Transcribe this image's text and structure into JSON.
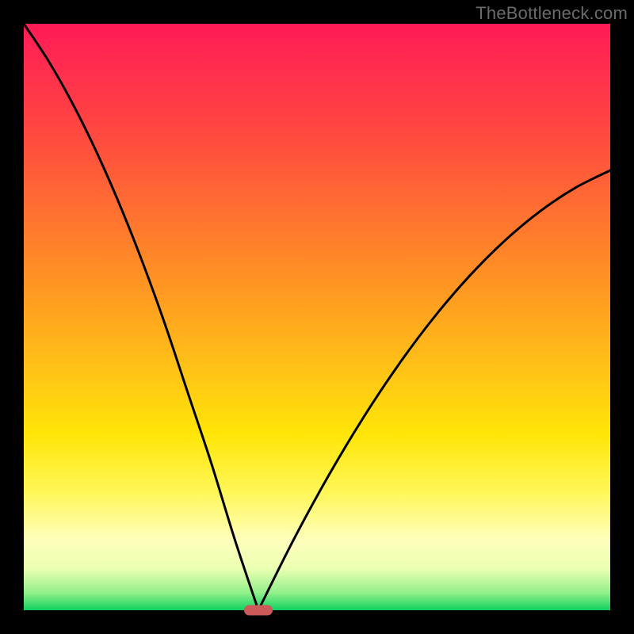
{
  "watermark": "TheBottleneck.com",
  "colors": {
    "frame": "#000000",
    "curve": "#000000",
    "marker": "#cc5a5a",
    "gradient_stops": [
      "#ff1a55",
      "#ff2a50",
      "#ff4143",
      "#ff6a33",
      "#ff9423",
      "#ffc018",
      "#ffe508",
      "#fff75a",
      "#ffffbc",
      "#eaffb1",
      "#92f08a",
      "#10d060"
    ]
  },
  "chart_data": {
    "type": "line",
    "title": "",
    "xlabel": "",
    "ylabel": "",
    "xlim": [
      0,
      100
    ],
    "ylim": [
      0,
      100
    ],
    "notes": "Two steep convex branches meeting near x≈40, y≈0 (V-shaped bottleneck curve). Background heat-gradient encodes y from red (100) to green (0). Small rounded marker at the minimum.",
    "series": [
      {
        "name": "left-branch",
        "x": [
          0,
          4,
          8,
          12,
          16,
          20,
          24,
          28,
          32,
          36,
          40
        ],
        "y": [
          100,
          94,
          87,
          79,
          70,
          60,
          49,
          37,
          25,
          12,
          0
        ]
      },
      {
        "name": "right-branch",
        "x": [
          40,
          46,
          52,
          58,
          64,
          70,
          76,
          82,
          88,
          94,
          100
        ],
        "y": [
          0,
          12,
          23,
          33,
          42,
          50,
          57,
          63,
          68,
          72,
          75
        ]
      }
    ],
    "marker": {
      "x": 40,
      "y": 0
    }
  }
}
